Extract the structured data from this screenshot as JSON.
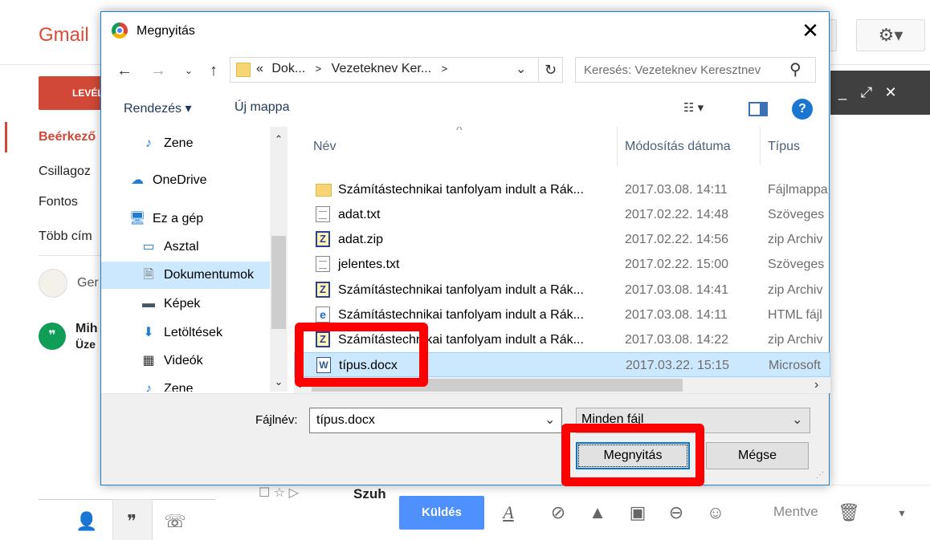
{
  "gmail": {
    "logo": "Gmail",
    "compose_label": "LEVÉL",
    "nav": {
      "inbox": "Beérkező",
      "starred": "Csillagoz",
      "important": "Fontos",
      "more": "Több cím"
    },
    "hangout_name": "Ger",
    "contact_name": "Mih",
    "contact_msg": "Üze",
    "email_row_sender": "Szuh",
    "send_label": "Küldés",
    "draft_saved": "Mentve"
  },
  "dialog": {
    "title": "Megnyitás",
    "address": {
      "prefix": "«",
      "crumb1": "Dok...",
      "crumb2": "Vezeteknev Ker..."
    },
    "search_placeholder": "Keresés: Vezeteknev Keresztnev",
    "toolbar": {
      "organize": "Rendezés ▾",
      "new_folder": "Új mappa"
    },
    "nav_pane": [
      {
        "label": "Zene",
        "icon": "music-icon"
      },
      {
        "label": "OneDrive",
        "icon": "cloud-icon"
      },
      {
        "label": "Ez a gép",
        "icon": "computer-icon"
      },
      {
        "label": "Asztal",
        "icon": "desktop-icon"
      },
      {
        "label": "Dokumentumok",
        "icon": "documents-icon"
      },
      {
        "label": "Képek",
        "icon": "pictures-icon"
      },
      {
        "label": "Letöltések",
        "icon": "download-icon"
      },
      {
        "label": "Videók",
        "icon": "video-icon"
      },
      {
        "label": "Zene",
        "icon": "music-icon"
      }
    ],
    "columns": {
      "name": "Név",
      "date": "Módosítás dátuma",
      "type": "Típus"
    },
    "files": [
      {
        "name": "Számítástechnikai tanfolyam indult a Rák...",
        "date": "2017.03.08. 14:11",
        "type": "Fájlmappa",
        "icon": "folder"
      },
      {
        "name": "adat.txt",
        "date": "2017.02.22. 14:48",
        "type": "Szöveges",
        "icon": "txt"
      },
      {
        "name": "adat.zip",
        "date": "2017.02.22. 14:56",
        "type": "zip Archiv",
        "icon": "zip"
      },
      {
        "name": "jelentes.txt",
        "date": "2017.02.22. 15:00",
        "type": "Szöveges",
        "icon": "txt"
      },
      {
        "name": "Számítástechnikai tanfolyam indult a Rák...",
        "date": "2017.03.08. 14:41",
        "type": "zip Archiv",
        "icon": "zip"
      },
      {
        "name": "Számítástechnikai tanfolyam indult a Rák...",
        "date": "2017.03.08. 14:11",
        "type": "HTML fájl",
        "icon": "html"
      },
      {
        "name": "Számítástechnikai tanfolyam indult a Rák...",
        "date": "2017.03.08. 14:22",
        "type": "zip Archiv",
        "icon": "zip"
      },
      {
        "name": "típus.docx",
        "date": "2017.03.22. 15:15",
        "type": "Microsoft",
        "icon": "docx"
      }
    ],
    "filename_label": "Fájlnév:",
    "filename_value": "típus.docx",
    "filter_value": "Minden fájl",
    "open_label": "Megnyitás",
    "cancel_label": "Mégse"
  }
}
